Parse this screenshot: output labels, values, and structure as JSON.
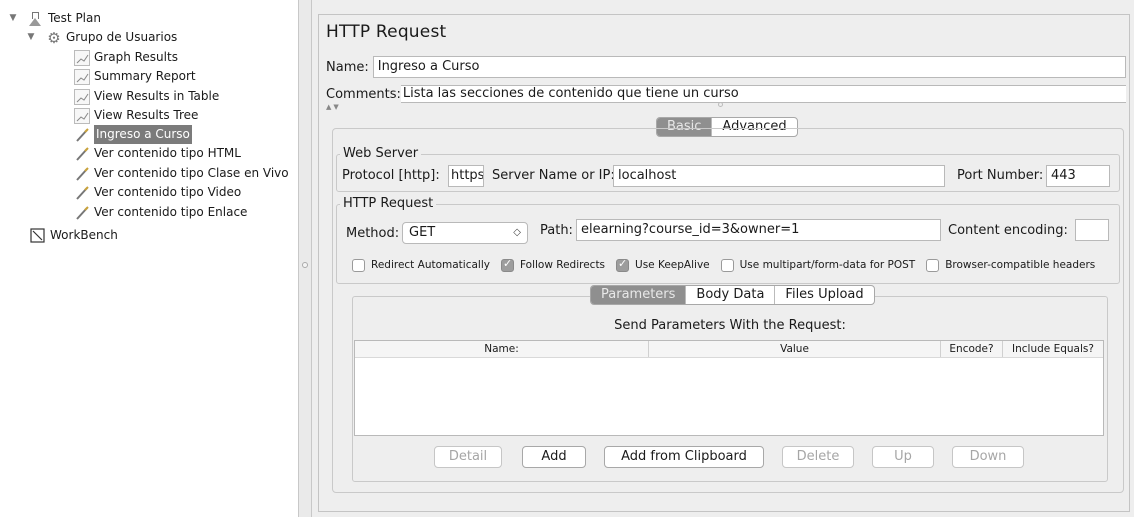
{
  "tree": {
    "items": [
      {
        "label": "Test Plan",
        "icon": "test-plan-icon"
      },
      {
        "label": "Grupo de Usuarios",
        "icon": "gear-icon"
      },
      {
        "label": "Graph Results",
        "icon": "graph-icon"
      },
      {
        "label": "Summary Report",
        "icon": "graph-icon"
      },
      {
        "label": "View Results in Table",
        "icon": "graph-icon"
      },
      {
        "label": "View Results Tree",
        "icon": "graph-icon"
      },
      {
        "label": "Ingreso a Curso",
        "icon": "pen-icon",
        "selected": true
      },
      {
        "label": "Ver contenido tipo HTML",
        "icon": "pen-icon"
      },
      {
        "label": "Ver contenido tipo Clase en Vivo",
        "icon": "pen-icon"
      },
      {
        "label": "Ver contenido tipo Video",
        "icon": "pen-icon"
      },
      {
        "label": "Ver contenido tipo Enlace",
        "icon": "pen-icon"
      },
      {
        "label": "WorkBench",
        "icon": "workbench-icon"
      }
    ]
  },
  "panel": {
    "title": "HTTP Request",
    "name_label": "Name:",
    "name_value": "Ingreso a Curso",
    "comments_label": "Comments:",
    "comments_value": "Lista las secciones de contenido que tiene un curso",
    "tabs": [
      "Basic",
      "Advanced"
    ],
    "active_tab": "Basic"
  },
  "web_server": {
    "group_title": "Web Server",
    "protocol_label": "Protocol [http]:",
    "protocol_value": "https",
    "server_label": "Server Name or IP:",
    "server_value": "localhost",
    "port_label": "Port Number:",
    "port_value": "443"
  },
  "http_request": {
    "group_title": "HTTP Request",
    "method_label": "Method:",
    "method_value": "GET",
    "path_label": "Path:",
    "path_value": "elearning?course_id=3&owner=1",
    "encoding_label": "Content encoding:",
    "encoding_value": ""
  },
  "options": [
    {
      "label": "Redirect Automatically",
      "checked": false
    },
    {
      "label": "Follow Redirects",
      "checked": true
    },
    {
      "label": "Use KeepAlive",
      "checked": true
    },
    {
      "label": "Use multipart/form-data for POST",
      "checked": false
    },
    {
      "label": "Browser-compatible headers",
      "checked": false
    }
  ],
  "sub_tabs": [
    "Parameters",
    "Body Data",
    "Files Upload"
  ],
  "params": {
    "title": "Send Parameters With the Request:",
    "columns": [
      "Name:",
      "Value",
      "Encode?",
      "Include Equals?"
    ],
    "rows": []
  },
  "buttons": {
    "detail": "Detail",
    "add": "Add",
    "add_clipboard": "Add from Clipboard",
    "delete": "Delete",
    "up": "Up",
    "down": "Down"
  }
}
